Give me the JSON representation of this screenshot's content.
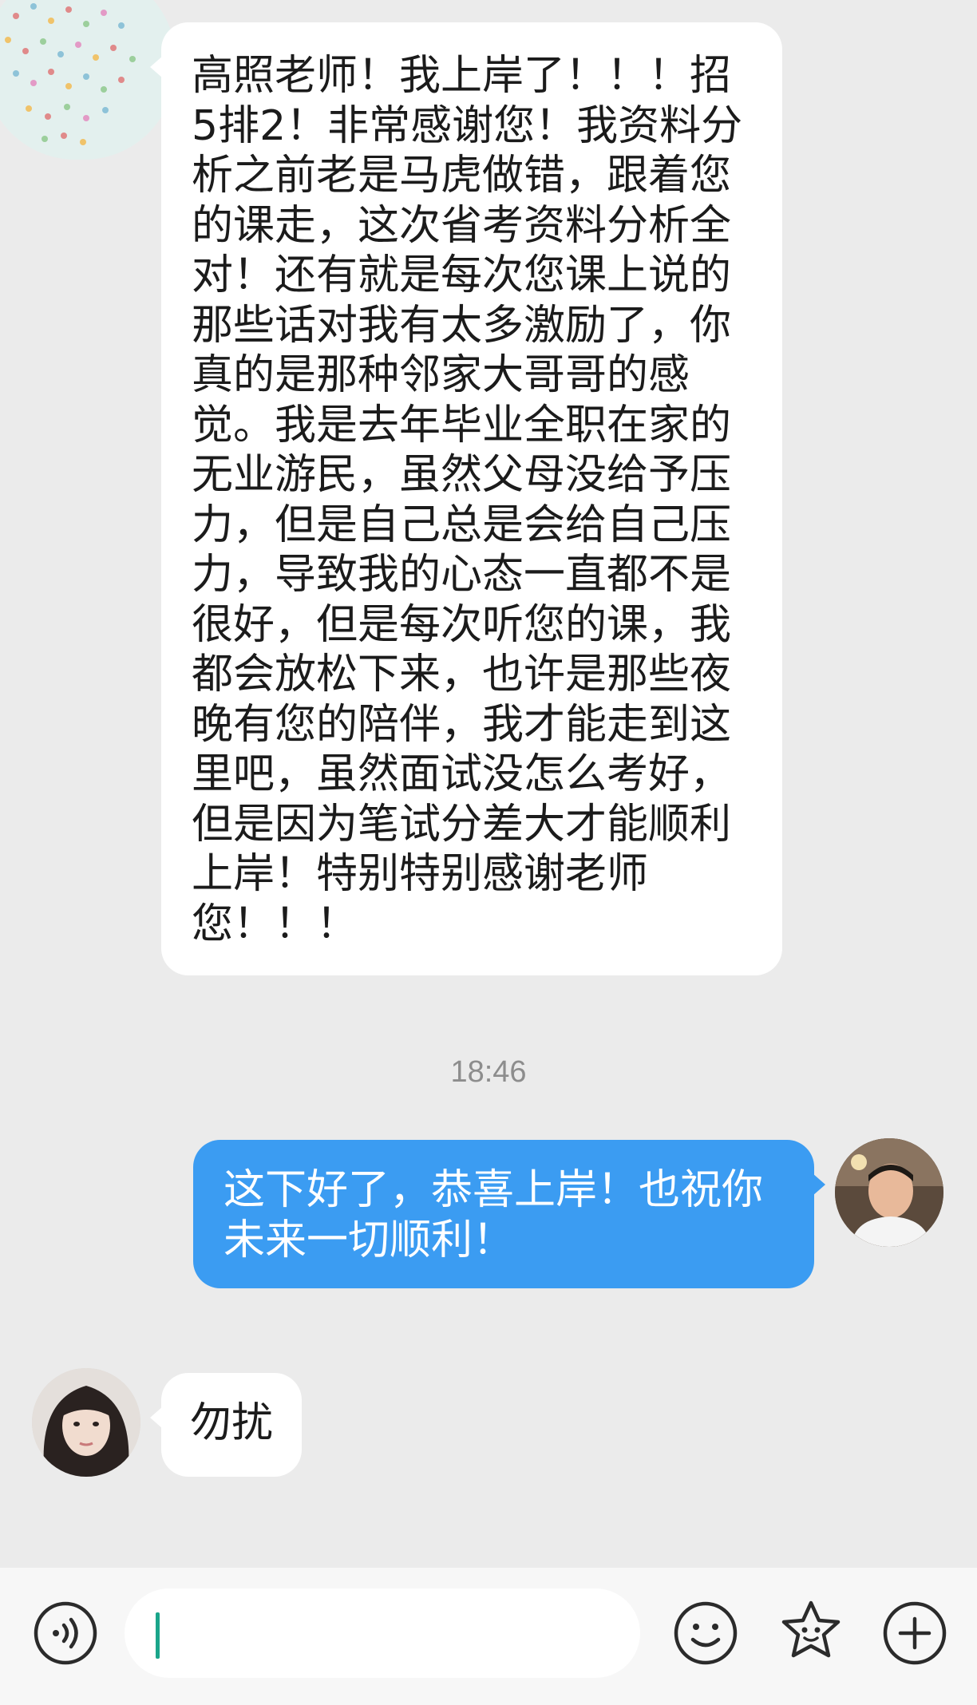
{
  "messages": {
    "incoming_long": {
      "text": "高照老师！我上岸了！！！招5排2！非常感谢您！我资料分析之前老是马虎做错，跟着您的课走，这次省考资料分析全对！还有就是每次您课上说的那些话对我有太多激励了，你真的是那种邻家大哥哥的感觉。我是去年毕业全职在家的无业游民，虽然父母没给予压力，但是自己总是会给自己压力，导致我的心态一直都不是很好，但是每次听您的课，我都会放松下来，也许是那些夜晚有您的陪伴，我才能走到这里吧，虽然面试没怎么考好，但是因为笔试分差大才能顺利上岸！特别特别感谢老师您！！！"
    },
    "timestamp": "18:46",
    "outgoing": {
      "text": "这下好了，恭喜上岸！也祝你未来一切顺利！"
    },
    "incoming_short": {
      "text": "勿扰"
    }
  },
  "input": {
    "value": ""
  },
  "colors": {
    "background": "#ebebeb",
    "incoming_bubble": "#ffffff",
    "outgoing_bubble": "#3b9cf2",
    "caret": "#1aa58a",
    "icon": "#2b2b2b"
  },
  "icons": {
    "voice": "voice-icon",
    "emoji": "emoji-icon",
    "sticker": "sticker-icon",
    "plus": "plus-icon"
  }
}
